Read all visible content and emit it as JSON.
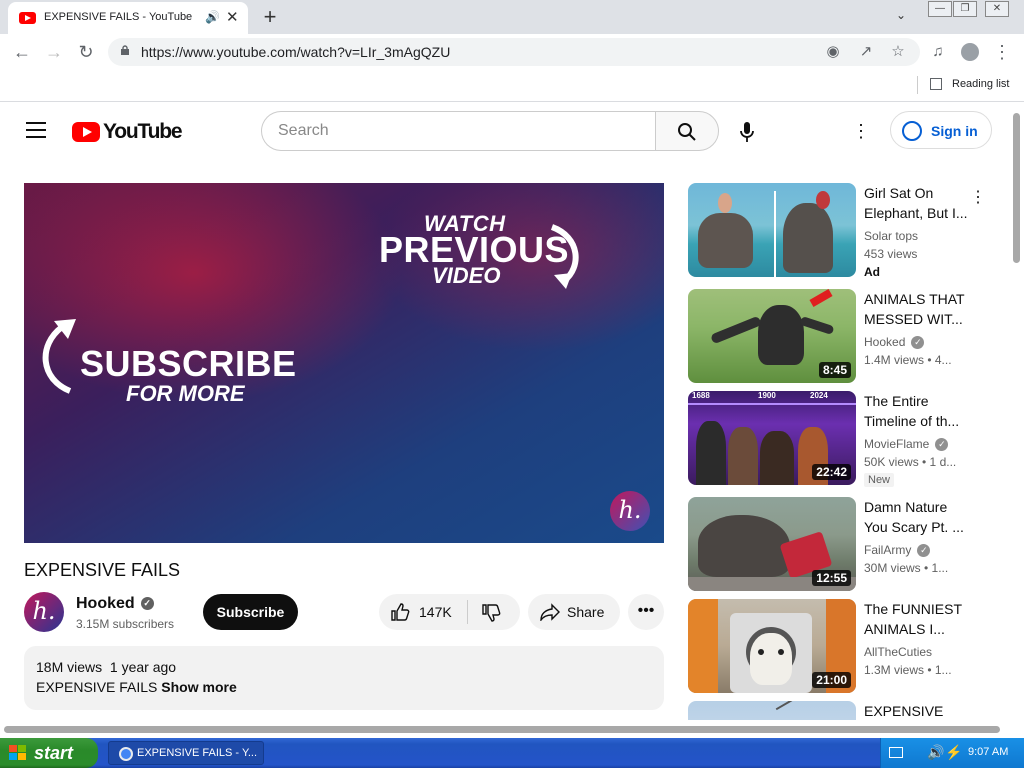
{
  "browser": {
    "tab_title": "EXPENSIVE FAILS - YouTube",
    "url": "https://www.youtube.com/watch?v=LIr_3mAgQZU",
    "reading_list": "Reading list"
  },
  "header": {
    "logo_text": "YouTube",
    "search_placeholder": "Search",
    "signin": "Sign in"
  },
  "player": {
    "watch": "WATCH",
    "previous": "PREVIOUS",
    "video": "VIDEO",
    "subscribe": "SUBSCRIBE",
    "for_more": "FOR MORE",
    "badge": "h."
  },
  "video": {
    "title": "EXPENSIVE FAILS",
    "channel": "Hooked",
    "subscribers": "3.15M subscribers",
    "subscribe_label": "Subscribe",
    "likes": "147K",
    "share_label": "Share",
    "channel_initial": "h.",
    "views": "18M views",
    "age": "1 year ago",
    "desc_text": "EXPENSIVE FAILS",
    "show_more": "Show more"
  },
  "recommendations": [
    {
      "title": "Girl Sat On Elephant, But I...",
      "channel": "Solar tops",
      "views": "453 views",
      "badge": "Ad",
      "duration": "",
      "verified": false
    },
    {
      "title": "ANIMALS THAT MESSED WIT...",
      "channel": "Hooked",
      "views": "1.4M views • 4...",
      "badge": "",
      "duration": "8:45",
      "verified": true
    },
    {
      "title": "The Entire Timeline of th...",
      "channel": "MovieFlame",
      "views": "50K views • 1 d...",
      "badge": "New",
      "duration": "22:42",
      "verified": true,
      "thumb_years": [
        "1688",
        "1900",
        "2024"
      ]
    },
    {
      "title": "Damn Nature You Scary Pt. ...",
      "channel": "FailArmy",
      "views": "30M views • 1...",
      "badge": "",
      "duration": "12:55",
      "verified": true
    },
    {
      "title": "The FUNNIEST ANIMALS I...",
      "channel": "AllTheCuties",
      "views": "1.3M views • 1...",
      "badge": "",
      "duration": "21:00",
      "verified": false
    },
    {
      "title": "EXPENSIVE",
      "channel": "",
      "views": "",
      "badge": "",
      "duration": "",
      "verified": false
    }
  ],
  "taskbar": {
    "start": "start",
    "task_label": "EXPENSIVE FAILS - Y...",
    "clock": "9:07 AM"
  }
}
